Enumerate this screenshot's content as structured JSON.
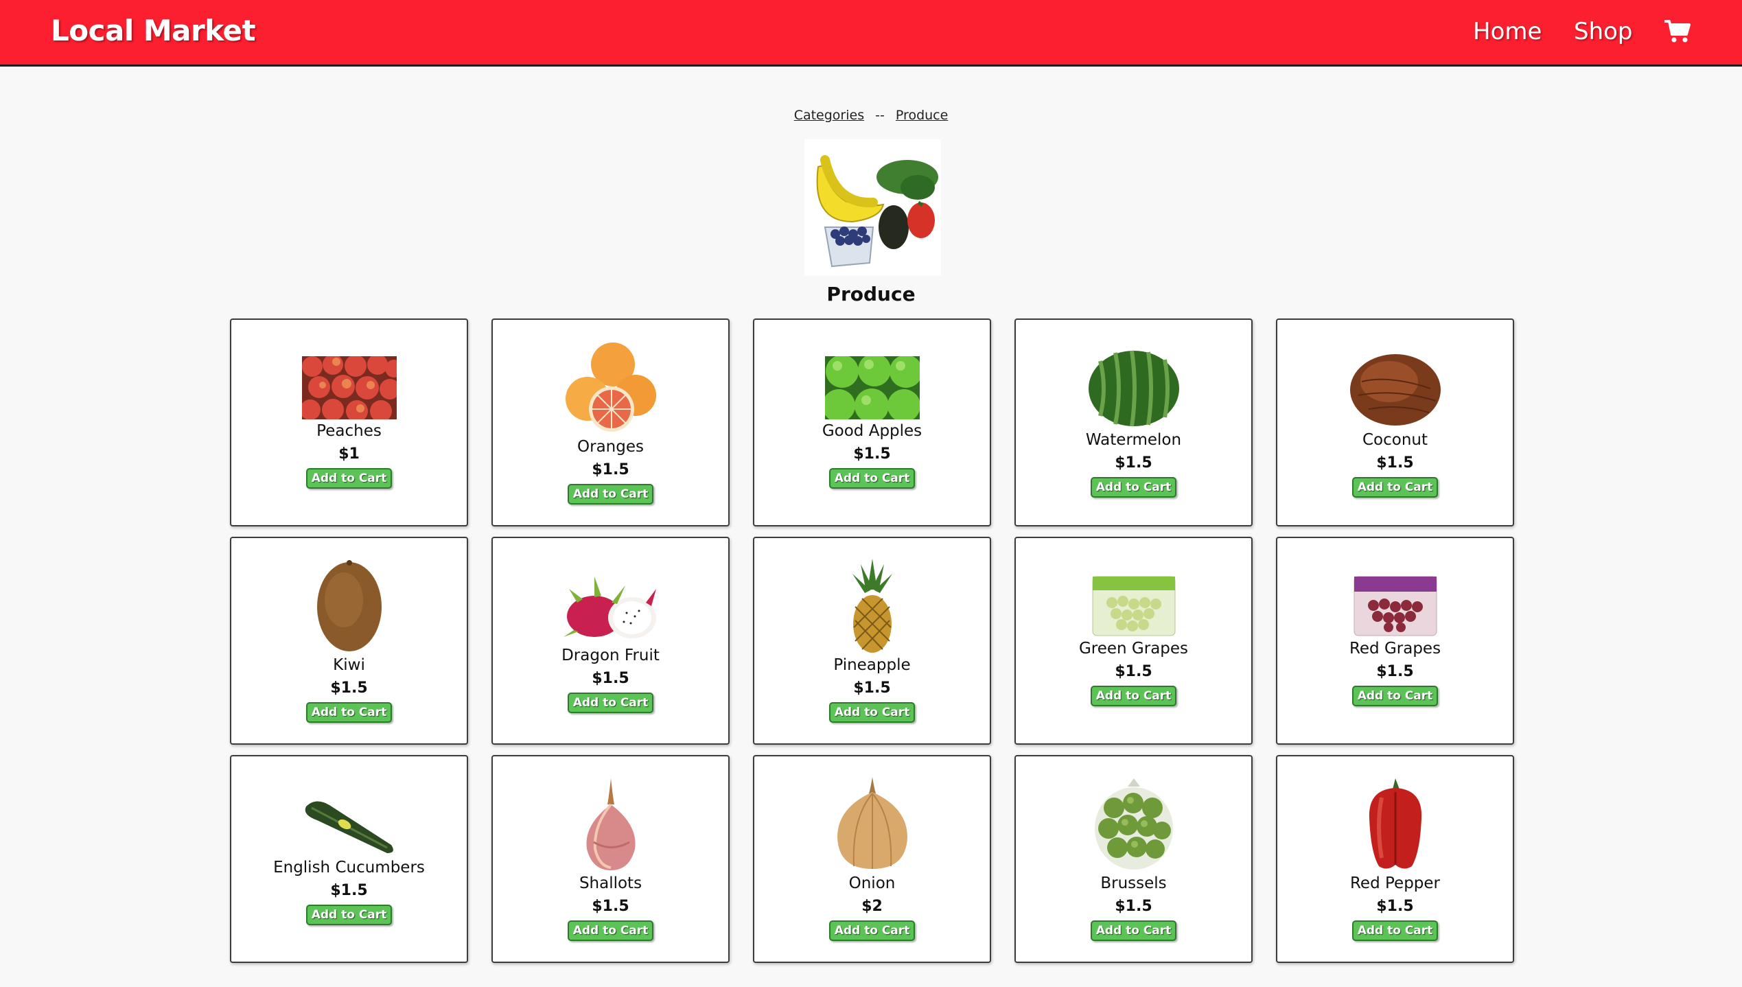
{
  "navbar": {
    "brand": "Local Market",
    "links": [
      {
        "label": "Home"
      },
      {
        "label": "Shop"
      }
    ],
    "cart_icon": "shopping-cart-icon",
    "background_color": "#fb1f2f"
  },
  "breadcrumb": {
    "items": [
      "Categories",
      "Produce"
    ],
    "separator": "--"
  },
  "category": {
    "title": "Produce",
    "image": "produce-assortment-image"
  },
  "products": [
    {
      "name": "Peaches",
      "price": "$1",
      "button": "Add to Cart",
      "image": "peaches-image"
    },
    {
      "name": "Oranges",
      "price": "$1.5",
      "button": "Add to Cart",
      "image": "oranges-image"
    },
    {
      "name": "Good Apples",
      "price": "$1.5",
      "button": "Add to Cart",
      "image": "green-apples-image"
    },
    {
      "name": "Watermelon",
      "price": "$1.5",
      "button": "Add to Cart",
      "image": "watermelon-image"
    },
    {
      "name": "Coconut",
      "price": "$1.5",
      "button": "Add to Cart",
      "image": "coconut-image"
    },
    {
      "name": "Kiwi",
      "price": "$1.5",
      "button": "Add to Cart",
      "image": "kiwi-image"
    },
    {
      "name": "Dragon Fruit",
      "price": "$1.5",
      "button": "Add to Cart",
      "image": "dragon-fruit-image"
    },
    {
      "name": "Pineapple",
      "price": "$1.5",
      "button": "Add to Cart",
      "image": "pineapple-image"
    },
    {
      "name": "Green Grapes",
      "price": "$1.5",
      "button": "Add to Cart",
      "image": "green-grapes-image"
    },
    {
      "name": "Red Grapes",
      "price": "$1.5",
      "button": "Add to Cart",
      "image": "red-grapes-image"
    },
    {
      "name": "English Cucumbers",
      "price": "$1.5",
      "button": "Add to Cart",
      "image": "cucumber-image"
    },
    {
      "name": "Shallots",
      "price": "$1.5",
      "button": "Add to Cart",
      "image": "shallot-image"
    },
    {
      "name": "Onion",
      "price": "$2",
      "button": "Add to Cart",
      "image": "onion-image"
    },
    {
      "name": "Brussels",
      "price": "$1.5",
      "button": "Add to Cart",
      "image": "brussels-sprouts-image"
    },
    {
      "name": "Red Pepper",
      "price": "$1.5",
      "button": "Add to Cart",
      "image": "red-pepper-image"
    }
  ],
  "colors": {
    "accent": "#fb1f2f",
    "button": "#5cc457",
    "page_background": "#f8f8f8"
  }
}
